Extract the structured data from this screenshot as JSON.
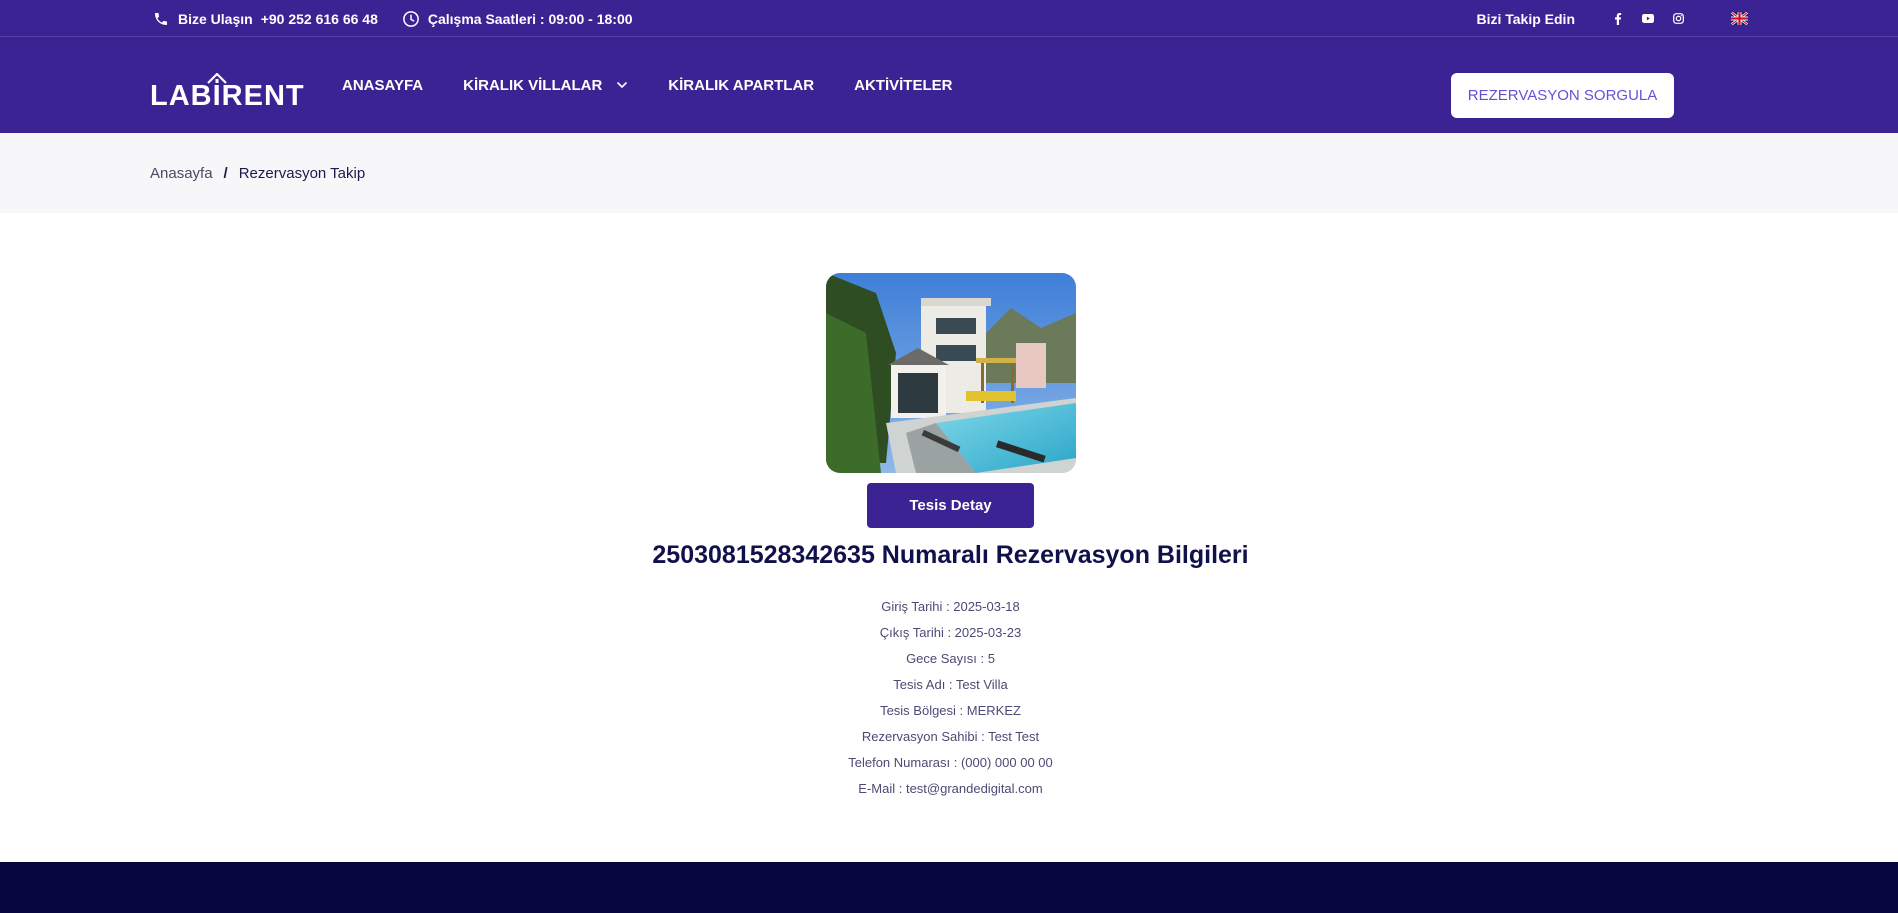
{
  "topbar": {
    "contact_label": "Bize Ulaşın",
    "phone": "+90 252 616 66 48",
    "hours": "Çalışma Saatleri : 09:00 - 18:00",
    "follow_label": "Bizi Takip Edin",
    "social_icons": [
      "facebook-icon",
      "youtube-icon",
      "instagram-icon"
    ],
    "language_icon": "uk-flag-icon"
  },
  "nav": {
    "logo": "LABIRENT",
    "items": [
      {
        "label": "ANASAYFA"
      },
      {
        "label": "KİRALIK VİLLALAR",
        "has_dropdown": true
      },
      {
        "label": "KİRALIK APARTLAR"
      },
      {
        "label": "AKTİVİTELER"
      }
    ],
    "cta_label": "REZERVASYON SORGULA"
  },
  "breadcrumb": {
    "home": "Anasayfa",
    "separator": "/",
    "current": "Rezervasyon Takip"
  },
  "reservation": {
    "detail_button": "Tesis Detay",
    "title": "2503081528342635 Numaralı Rezervasyon Bilgileri",
    "rows": [
      "Giriş Tarihi : 2025-03-18",
      "Çıkış Tarihi : 2025-03-23",
      "Gece Sayısı : 5",
      "Tesis Adı : Test Villa",
      "Tesis Bölgesi : MERKEZ",
      "Rezervasyon Sahibi : Test Test",
      "Telefon Numarası : (000) 000 00 00",
      "E-Mail : test@grandedigital.com"
    ]
  },
  "colors": {
    "brand": "#3c2394",
    "cta_text": "#6a4fd6",
    "footer": "#05053f",
    "title": "#10104a"
  }
}
